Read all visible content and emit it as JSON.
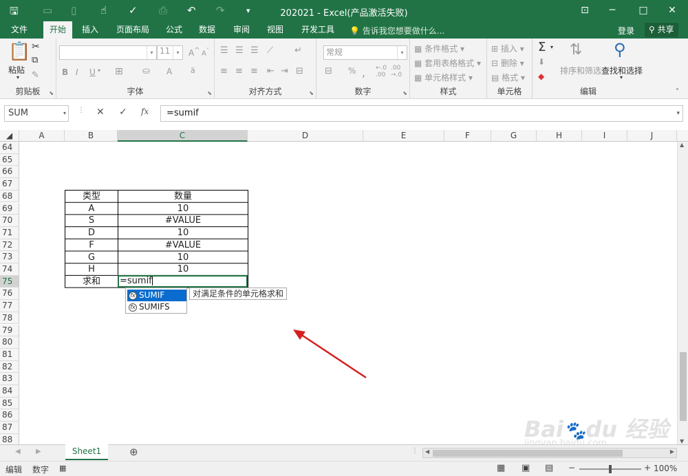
{
  "window": {
    "title": "202021 - Excel(产品激活失败)"
  },
  "menu_tabs": [
    "文件",
    "开始",
    "插入",
    "页面布局",
    "公式",
    "数据",
    "审阅",
    "视图",
    "开发工具"
  ],
  "tell_me": "告诉我您想要做什么...",
  "login": "登录",
  "share": "共享",
  "ribbon": {
    "clipboard": {
      "label": "剪贴板",
      "paste": "粘贴"
    },
    "font": {
      "label": "字体",
      "size": "11",
      "bold": "B",
      "italic": "I",
      "underline": "U"
    },
    "alignment": {
      "label": "对齐方式"
    },
    "number": {
      "label": "数字",
      "format": "常规"
    },
    "styles": {
      "label": "样式",
      "conditional": "条件格式",
      "table": "套用表格格式",
      "cell": "单元格样式"
    },
    "cells": {
      "label": "单元格",
      "insert": "插入",
      "delete": "删除",
      "format": "格式"
    },
    "editing": {
      "label": "编辑",
      "sort": "排序和筛选",
      "find": "查找和选择"
    }
  },
  "name_box": "SUM",
  "formula_bar": {
    "cancel": "✕",
    "enter": "✓",
    "fx": "fx",
    "value": "=sumif"
  },
  "columns": [
    "A",
    "B",
    "C",
    "D",
    "E",
    "F",
    "G",
    "H",
    "I",
    "J"
  ],
  "rows": [
    "64",
    "65",
    "66",
    "67",
    "68",
    "69",
    "70",
    "71",
    "72",
    "73",
    "74",
    "75",
    "76",
    "77",
    "78",
    "79",
    "80",
    "81",
    "82",
    "83",
    "84",
    "85",
    "86",
    "87",
    "88"
  ],
  "table": {
    "header": [
      "类型",
      "数量"
    ],
    "rows": [
      [
        "A",
        "10"
      ],
      [
        "S",
        "#VALUE"
      ],
      [
        "D",
        "10"
      ],
      [
        "F",
        "#VALUE"
      ],
      [
        "G",
        "10"
      ],
      [
        "H",
        "10"
      ]
    ],
    "sum_label": "求和"
  },
  "edit_cell_text": "=sumif",
  "autocomplete": [
    "SUMIF",
    "SUMIFS"
  ],
  "tooltip": "对满足条件的单元格求和",
  "sheet_tab": "Sheet1",
  "status": {
    "mode": "编辑",
    "numlock": "数字",
    "zoom": "100%"
  },
  "watermark": "Baidu经验 jingyan.baidu.com",
  "colors": {
    "excel_green": "#217346",
    "highlight_blue": "#0a6cce",
    "arrow_red": "#d42020"
  }
}
